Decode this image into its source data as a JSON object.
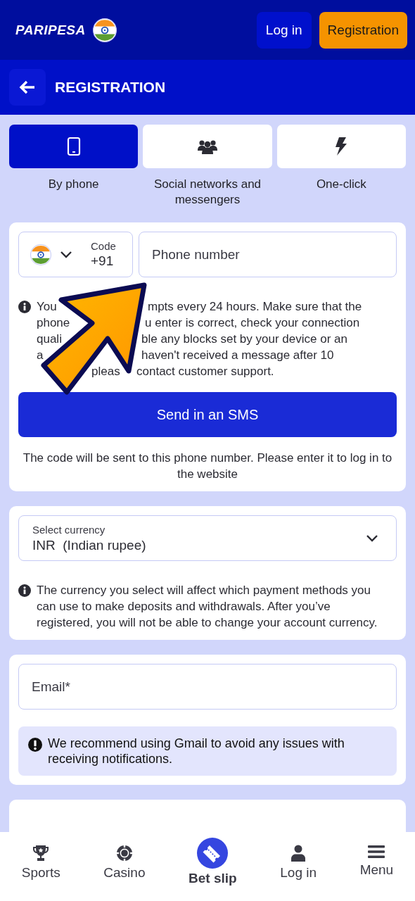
{
  "header": {
    "logo": "PARIPESA",
    "buttons": [
      {
        "label": "Log in",
        "kind": "secondary"
      },
      {
        "label": "Registration",
        "kind": "primary"
      }
    ]
  },
  "title_bar": {
    "title": "REGISTRATION"
  },
  "methods": [
    {
      "label": "By phone",
      "kind": "phone",
      "selected": true
    },
    {
      "label": "Social networks and messengers",
      "kind": "social",
      "selected": false
    },
    {
      "label": "One-click",
      "kind": "one_click",
      "selected": false
    }
  ],
  "phone_card": {
    "code": {
      "label": "Code",
      "value": "+91"
    },
    "phone_field": {
      "placeholder": "Phone number"
    },
    "notice_lines": [
      [
        "You",
        "mpts every 24 hours. Make sure that the"
      ],
      [
        "phone",
        "u enter is correct, check your connection"
      ],
      [
        "quali",
        "ble any blocks set by your device or an"
      ],
      [
        "a",
        "haven't received a message after 10"
      ],
      [
        "pleas",
        "contact customer support."
      ]
    ],
    "button": "Send in an SMS",
    "note": "The code will be sent to this phone number. Please enter it to log in to the website"
  },
  "currency_card": {
    "select": {
      "label": "Select currency",
      "value": "INR  (Indian rupee)"
    },
    "notice": "The currency you select will affect which payment methods you can use to make deposits and withdrawals. After you’ve registered, you will not be able to change your account currency."
  },
  "email_card": {
    "field": {
      "placeholder": "Email*"
    },
    "notice": "We recommend using Gmail to avoid any issues with receiving notifications."
  },
  "bottom_nav": [
    {
      "label": "Sports",
      "kind": "regular"
    },
    {
      "label": "Casino",
      "kind": "regular"
    },
    {
      "label": "Bet slip",
      "kind": "featured"
    },
    {
      "label": "Log in",
      "kind": "regular"
    },
    {
      "label": "Menu",
      "kind": "regular"
    }
  ]
}
